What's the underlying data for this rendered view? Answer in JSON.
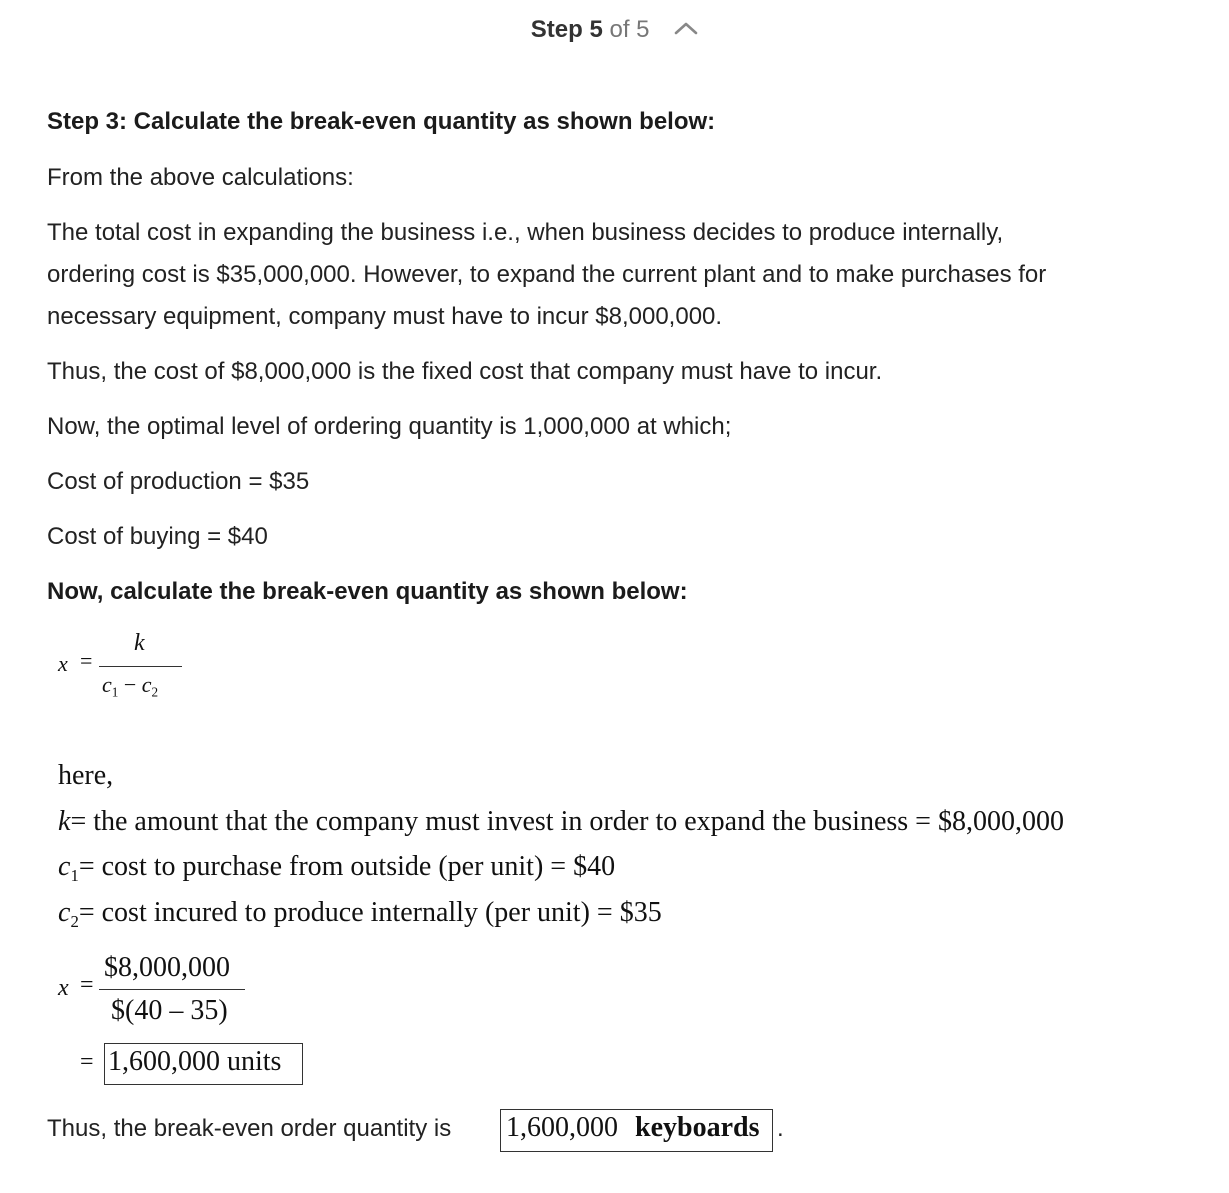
{
  "header": {
    "step_word": "Step",
    "step_current": "5",
    "step_of": "of 5",
    "chevron_icon": "chevron-up-icon"
  },
  "content": {
    "heading_step3": "Step 3: Calculate the break-even quantity as shown below:",
    "from_above": "From the above calculations:",
    "total_cost_line1": "The total cost in expanding the business i.e., when business decides to produce internally,",
    "total_cost_line2": "ordering cost is $35,000,000. However, to expand the current plant and to make purchases for",
    "total_cost_line3": "necessary equipment, company must have to incur $8,000,000.",
    "fixed_cost": "Thus, the cost of $8,000,000 is the fixed cost that company must have to incur.",
    "optimal_level": "Now, the optimal level of ordering quantity is 1,000,000 at which;",
    "cost_production": "Cost of production = $35",
    "cost_buying": "Cost of buying = $40",
    "heading_calculate": "Now, calculate the break-even quantity as shown below:",
    "conclusion_prefix": "Thus, the break-even order quantity is",
    "conclusion_boxed_num": "1,600,000",
    "conclusion_boxed_word": "keyboards",
    "conclusion_suffix": "."
  },
  "formula": {
    "x": "x",
    "equals": "=",
    "k": "k",
    "c1": "c",
    "c1_sub": "1",
    "minus": "−",
    "c2": "c",
    "c2_sub": "2"
  },
  "definitions": {
    "here": "here,",
    "k_var": "k",
    "k_def": "= the amount that the company must invest in order to expand the business = $8,000,000",
    "c1_var": "c",
    "c1_sub": "1",
    "c1_def": "= cost to purchase from outside (per unit) = $40",
    "c2_var": "c",
    "c2_sub": "2",
    "c2_def": "= cost incured to produce internally (per unit) = $35"
  },
  "calculation": {
    "x": "x",
    "equals": "=",
    "numerator": "$8,000,000",
    "denominator": "$(40 – 35)",
    "result_equals": "=",
    "result": "1,600,000 units"
  }
}
